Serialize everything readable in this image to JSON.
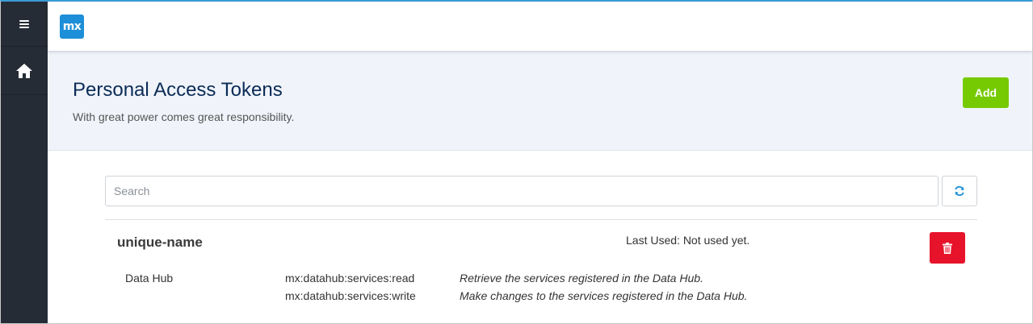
{
  "app": {
    "logo_text": "mx",
    "accent_color": "#1d8fd8",
    "sidebar_color": "#252c36"
  },
  "sidebar": {
    "items": [
      {
        "icon": "hamburger-menu-icon"
      },
      {
        "icon": "home-icon"
      }
    ]
  },
  "header": {
    "title": "Personal Access Tokens",
    "subtitle": "With great power comes great responsibility.",
    "add_label": "Add",
    "add_color": "#76ca02"
  },
  "search": {
    "placeholder": "Search",
    "value": "",
    "refresh_icon": "refresh-icon"
  },
  "tokens": [
    {
      "name": "unique-name",
      "last_used": "Last Used: Not used yet.",
      "delete_icon": "trash-icon",
      "delete_color": "#e7132a",
      "app": "Data Hub",
      "scopes": [
        {
          "name": "mx:datahub:services:read",
          "description": "Retrieve the services registered in the Data Hub."
        },
        {
          "name": "mx:datahub:services:write",
          "description": "Make changes to the services registered in the Data Hub."
        }
      ]
    }
  ]
}
